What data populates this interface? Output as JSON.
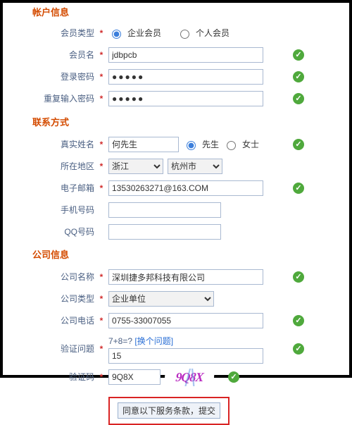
{
  "sections": {
    "s0_title": "帐户信息",
    "s1_title": "联系方式",
    "s2_title": "公司信息"
  },
  "account": {
    "memberType_label": "会员类型",
    "memberType_opts": {
      "a": "企业会员",
      "b": "个人会员"
    },
    "memberName_label": "会员名",
    "memberName_value": "jdbpcb",
    "loginPwd_label": "登录密码",
    "loginPwd_value": "●●●●●",
    "confirmPwd_label": "重复输入密码",
    "confirmPwd_value": "●●●●●"
  },
  "contact": {
    "realName_label": "真实姓名",
    "realName_value": "何先生",
    "gender_opts": {
      "m": "先生",
      "f": "女士"
    },
    "region_label": "所在地区",
    "region_prov": "浙江",
    "region_city": "杭州市",
    "email_label": "电子邮箱",
    "email_value": "13530263271@163.COM",
    "mobile_label": "手机号码",
    "mobile_value": "",
    "qq_label": "QQ号码",
    "qq_value": ""
  },
  "company": {
    "name_label": "公司名称",
    "name_value": "深圳捷多邦科技有限公司",
    "type_label": "公司类型",
    "type_value": "企业单位",
    "phone_label": "公司电话",
    "phone_value": "0755-33007055",
    "question_label": "验证问题",
    "question_text": "7+8=?",
    "question_change": "[换个问题]",
    "question_answer": "15",
    "captcha_label": "验证码",
    "captcha_input": "9Q8X",
    "captcha_image": "9Q8X"
  },
  "submit": {
    "label": "同意以下服务条款，提交"
  }
}
